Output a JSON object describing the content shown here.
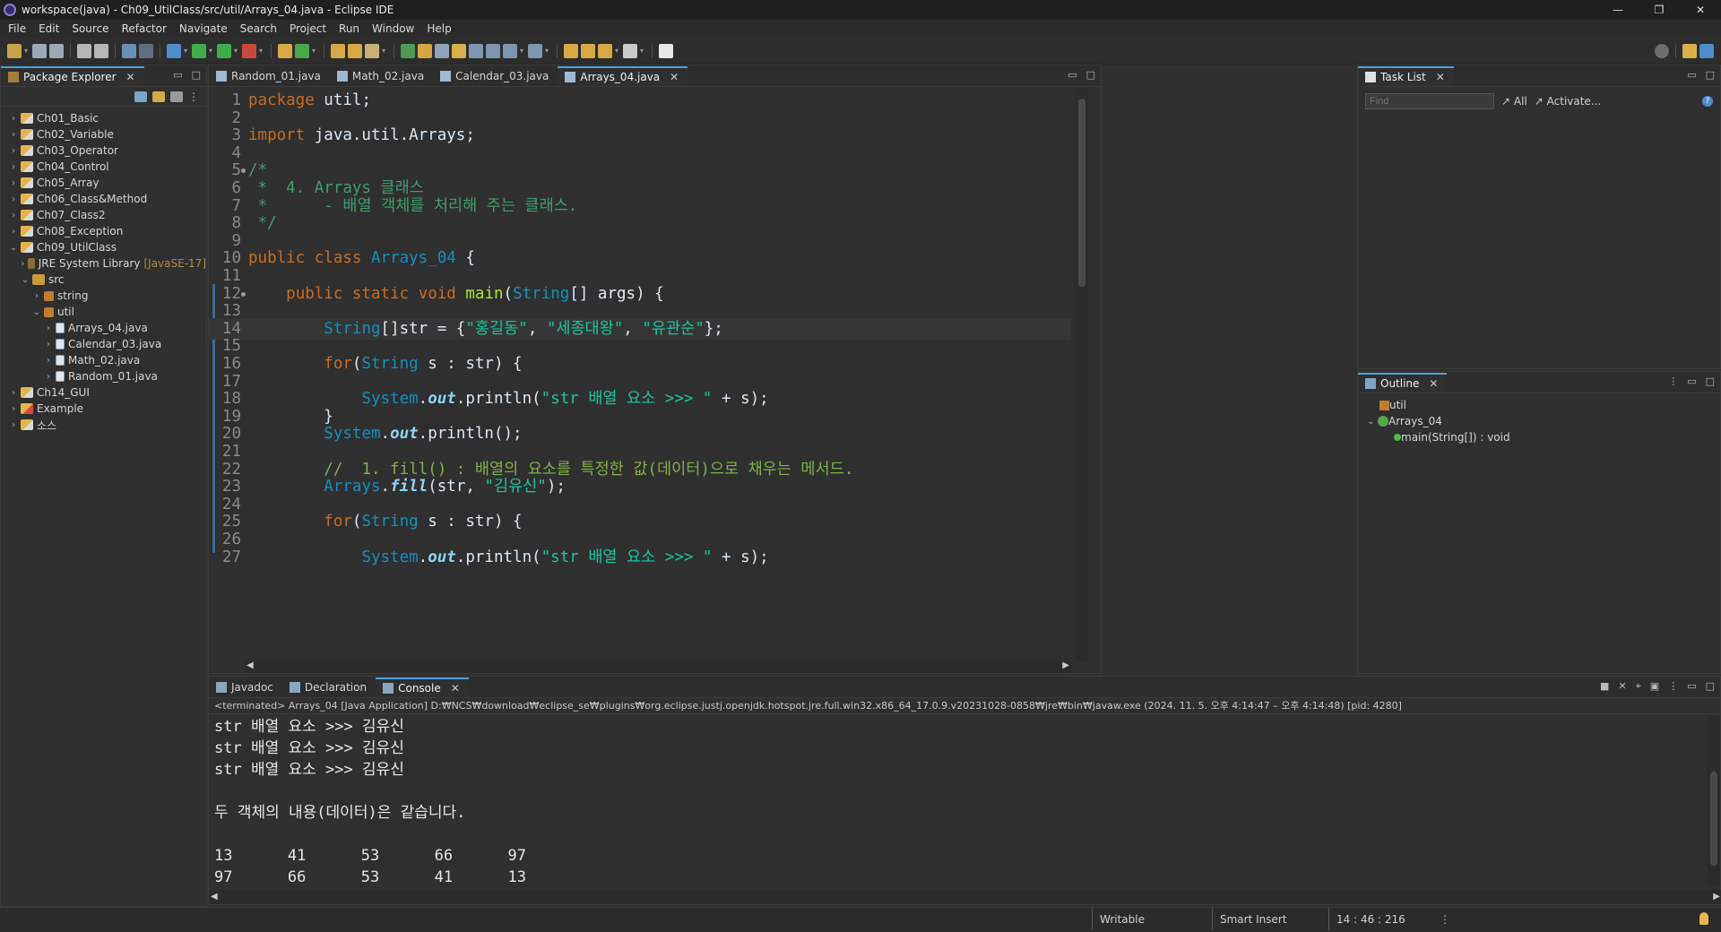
{
  "window": {
    "title": "workspace(java) - Ch09_UtilClass/src/util/Arrays_04.java - Eclipse IDE",
    "min": "—",
    "max": "❐",
    "close": "✕"
  },
  "menu": [
    "File",
    "Edit",
    "Source",
    "Refactor",
    "Navigate",
    "Search",
    "Project",
    "Run",
    "Window",
    "Help"
  ],
  "package_explorer": {
    "tab": "Package Explorer",
    "tree": [
      {
        "label": "Ch01_Basic",
        "depth": 0,
        "toggle": ">",
        "icon": "project"
      },
      {
        "label": "Ch02_Variable",
        "depth": 0,
        "toggle": ">",
        "icon": "project"
      },
      {
        "label": "Ch03_Operator",
        "depth": 0,
        "toggle": ">",
        "icon": "project"
      },
      {
        "label": "Ch04_Control",
        "depth": 0,
        "toggle": ">",
        "icon": "project"
      },
      {
        "label": "Ch05_Array",
        "depth": 0,
        "toggle": ">",
        "icon": "project"
      },
      {
        "label": "Ch06_Class&Method",
        "depth": 0,
        "toggle": ">",
        "icon": "project"
      },
      {
        "label": "Ch07_Class2",
        "depth": 0,
        "toggle": ">",
        "icon": "project"
      },
      {
        "label": "Ch08_Exception",
        "depth": 0,
        "toggle": ">",
        "icon": "project"
      },
      {
        "label": "Ch09_UtilClass",
        "depth": 0,
        "toggle": "v",
        "icon": "project"
      },
      {
        "label": "JRE System Library",
        "extra": "[JavaSE-17]",
        "depth": 1,
        "toggle": ">",
        "icon": "jre"
      },
      {
        "label": "src",
        "depth": 1,
        "toggle": "v",
        "icon": "src"
      },
      {
        "label": "string",
        "depth": 2,
        "toggle": ">",
        "icon": "package"
      },
      {
        "label": "util",
        "depth": 2,
        "toggle": "v",
        "icon": "package"
      },
      {
        "label": "Arrays_04.java",
        "depth": 3,
        "toggle": ">",
        "icon": "java"
      },
      {
        "label": "Calendar_03.java",
        "depth": 3,
        "toggle": ">",
        "icon": "java"
      },
      {
        "label": "Math_02.java",
        "depth": 3,
        "toggle": ">",
        "icon": "java"
      },
      {
        "label": "Random_01.java",
        "depth": 3,
        "toggle": ">",
        "icon": "java"
      },
      {
        "label": "Ch14_GUI",
        "depth": 0,
        "toggle": ">",
        "icon": "project"
      },
      {
        "label": "Example",
        "depth": 0,
        "toggle": ">",
        "icon": "project-error"
      },
      {
        "label": "소스",
        "depth": 0,
        "toggle": ">",
        "icon": "project"
      }
    ]
  },
  "editor": {
    "tabs": [
      {
        "label": "Random_01.java",
        "active": false
      },
      {
        "label": "Math_02.java",
        "active": false
      },
      {
        "label": "Calendar_03.java",
        "active": false
      },
      {
        "label": "Arrays_04.java",
        "active": true
      }
    ],
    "lines": [
      {
        "n": "1",
        "parts": [
          [
            "kw",
            "package"
          ],
          [
            "plain",
            " util;"
          ]
        ]
      },
      {
        "n": "2",
        "parts": []
      },
      {
        "n": "3",
        "parts": [
          [
            "kw",
            "import"
          ],
          [
            "plain",
            " java.util.Arrays;"
          ]
        ]
      },
      {
        "n": "4",
        "parts": []
      },
      {
        "n": "5",
        "fold": true,
        "parts": [
          [
            "cmdoc",
            "/*"
          ]
        ]
      },
      {
        "n": "6",
        "parts": [
          [
            "cmdoc",
            " *  4. Arrays 클래스"
          ]
        ]
      },
      {
        "n": "7",
        "parts": [
          [
            "cmdoc",
            " *      - 배열 객체를 처리해 주는 클래스."
          ]
        ]
      },
      {
        "n": "8",
        "parts": [
          [
            "cmdoc",
            " */"
          ]
        ]
      },
      {
        "n": "9",
        "parts": []
      },
      {
        "n": "10",
        "parts": [
          [
            "kw",
            "public"
          ],
          [
            "plain",
            " "
          ],
          [
            "kw",
            "class"
          ],
          [
            "plain",
            " "
          ],
          [
            "ty",
            "Arrays_04"
          ],
          [
            "plain",
            " {"
          ]
        ]
      },
      {
        "n": "11",
        "parts": []
      },
      {
        "n": "12",
        "fold": true,
        "parts": [
          [
            "plain",
            "    "
          ],
          [
            "kw",
            "public"
          ],
          [
            "plain",
            " "
          ],
          [
            "kw",
            "static"
          ],
          [
            "plain",
            " "
          ],
          [
            "kw",
            "void"
          ],
          [
            "plain",
            " "
          ],
          [
            "fn",
            "main"
          ],
          [
            "plain",
            "("
          ],
          [
            "ty",
            "String"
          ],
          [
            "plain",
            "[] "
          ],
          [
            "sm",
            "args"
          ],
          [
            "plain",
            ") {"
          ]
        ]
      },
      {
        "n": "13",
        "parts": []
      },
      {
        "n": "14",
        "current": true,
        "parts": [
          [
            "plain",
            "        "
          ],
          [
            "ty",
            "String"
          ],
          [
            "plain",
            "[]"
          ],
          [
            "sm",
            "str"
          ],
          [
            "plain",
            " = {"
          ],
          [
            "st",
            "\"홍길동\""
          ],
          [
            "plain",
            ", "
          ],
          [
            "st",
            "\"세종대왕\""
          ],
          [
            "plain",
            ", "
          ],
          [
            "st",
            "\"유관순\""
          ],
          [
            "plain",
            "};"
          ]
        ]
      },
      {
        "n": "15",
        "parts": []
      },
      {
        "n": "16",
        "parts": [
          [
            "plain",
            "        "
          ],
          [
            "kw",
            "for"
          ],
          [
            "plain",
            "("
          ],
          [
            "ty",
            "String"
          ],
          [
            "plain",
            " s : str) {"
          ]
        ]
      },
      {
        "n": "17",
        "parts": []
      },
      {
        "n": "18",
        "parts": [
          [
            "plain",
            "            "
          ],
          [
            "ty",
            "System"
          ],
          [
            "plain",
            "."
          ],
          [
            "fld",
            "out"
          ],
          [
            "plain",
            ".println("
          ],
          [
            "st",
            "\"str 배열 요소 >>> \""
          ],
          [
            "plain",
            " + s);"
          ]
        ]
      },
      {
        "n": "19",
        "parts": [
          [
            "plain",
            "        }"
          ]
        ]
      },
      {
        "n": "20",
        "parts": [
          [
            "plain",
            "        "
          ],
          [
            "ty",
            "System"
          ],
          [
            "plain",
            "."
          ],
          [
            "fld",
            "out"
          ],
          [
            "plain",
            ".println();"
          ]
        ]
      },
      {
        "n": "21",
        "parts": []
      },
      {
        "n": "22",
        "parts": [
          [
            "plain",
            "        "
          ],
          [
            "cm",
            "//  1. fill() : 배열의 요소를 특정한 값(데이터)으로 채우는 메서드."
          ]
        ]
      },
      {
        "n": "23",
        "parts": [
          [
            "plain",
            "        "
          ],
          [
            "ty",
            "Arrays"
          ],
          [
            "plain",
            "."
          ],
          [
            "fld",
            "fill"
          ],
          [
            "plain",
            "(str, "
          ],
          [
            "st",
            "\"김유신\""
          ],
          [
            "plain",
            ");"
          ]
        ]
      },
      {
        "n": "24",
        "parts": []
      },
      {
        "n": "25",
        "parts": [
          [
            "plain",
            "        "
          ],
          [
            "kw",
            "for"
          ],
          [
            "plain",
            "("
          ],
          [
            "ty",
            "String"
          ],
          [
            "plain",
            " s : str) {"
          ]
        ]
      },
      {
        "n": "26",
        "parts": []
      },
      {
        "n": "27",
        "parts": [
          [
            "plain",
            "            "
          ],
          [
            "ty",
            "System"
          ],
          [
            "plain",
            "."
          ],
          [
            "fld",
            "out"
          ],
          [
            "plain",
            ".println("
          ],
          [
            "st",
            "\"str 배열 요소 >>> \""
          ],
          [
            "plain",
            " + s);"
          ]
        ]
      }
    ]
  },
  "task_list": {
    "tab": "Task List",
    "find_placeholder": "Find",
    "all": "All",
    "activate": "Activate..."
  },
  "outline": {
    "tab": "Outline",
    "items": [
      {
        "label": "util",
        "icon": "package"
      },
      {
        "label": "Arrays_04",
        "icon": "class",
        "toggle": "v"
      },
      {
        "label": "main(String[]) : void",
        "icon": "method"
      }
    ]
  },
  "bottom": {
    "tabs": [
      {
        "label": "Javadoc",
        "active": false
      },
      {
        "label": "Declaration",
        "active": false
      },
      {
        "label": "Console",
        "active": true
      }
    ],
    "terminated": "<terminated> Arrays_04 [Java Application] D:₩NCS₩download₩eclipse_se₩plugins₩org.eclipse.justj.openjdk.hotspot.jre.full.win32.x86_64_17.0.9.v20231028-0858₩jre₩bin₩javaw.exe  (2024. 11. 5. 오후 4:14:47 – 오후 4:14:48) [pid: 4280]",
    "output": "str 배열 요소 >>> 김유신\nstr 배열 요소 >>> 김유신\nstr 배열 요소 >>> 김유신\n\n두 객체의 내용(데이터)은 같습니다.\n\n13\t41\t53\t66\t97\n97\t66\t53\t41\t13"
  },
  "status": {
    "writable": "Writable",
    "insert_mode": "Smart Insert",
    "position": "14 : 46 : 216"
  }
}
